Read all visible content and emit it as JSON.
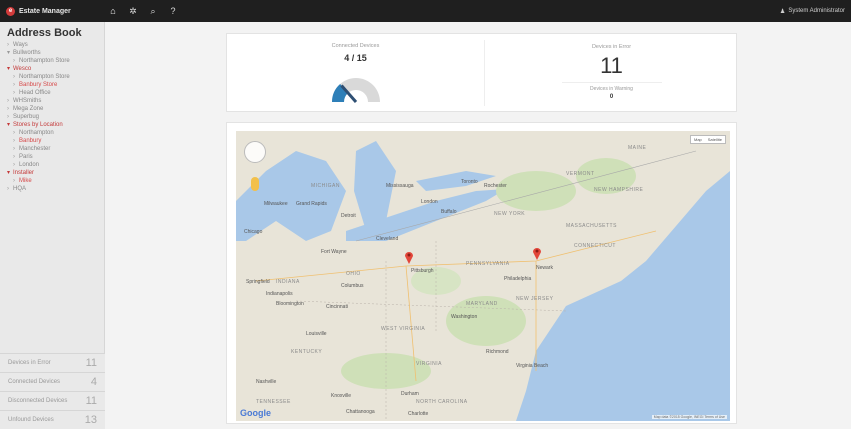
{
  "app": {
    "title": "Estate Manager",
    "logo_icon": "e-logo-icon"
  },
  "toolbar": {
    "tools": [
      {
        "name": "home-icon",
        "glyph": "⌂"
      },
      {
        "name": "gear-icon",
        "glyph": "✲"
      },
      {
        "name": "search-icon",
        "glyph": "⌕"
      },
      {
        "name": "help-icon",
        "glyph": "?"
      }
    ]
  },
  "user": {
    "icon": "user-icon",
    "name": "System Administrator"
  },
  "sidebar": {
    "title": "Address Book",
    "items": [
      {
        "label": "Ways",
        "marker": "›",
        "open": false,
        "selected": false,
        "indent": 0
      },
      {
        "label": "Bullworths",
        "marker": "▾",
        "open": false,
        "selected": false,
        "indent": 0
      },
      {
        "label": "Northampton Store",
        "marker": "›",
        "open": false,
        "selected": false,
        "indent": 1
      },
      {
        "label": "Wesco",
        "marker": "▾",
        "open": true,
        "selected": false,
        "indent": 0
      },
      {
        "label": "Northampton Store",
        "marker": "›",
        "open": false,
        "selected": false,
        "indent": 1
      },
      {
        "label": "Banbury Store",
        "marker": "›",
        "open": false,
        "selected": true,
        "indent": 1
      },
      {
        "label": "Head Office",
        "marker": "›",
        "open": false,
        "selected": false,
        "indent": 1
      },
      {
        "label": "WHSmiths",
        "marker": "›",
        "open": false,
        "selected": false,
        "indent": 0
      },
      {
        "label": "Mega Zone",
        "marker": "›",
        "open": false,
        "selected": false,
        "indent": 0
      },
      {
        "label": "Superbug",
        "marker": "›",
        "open": false,
        "selected": false,
        "indent": 0
      },
      {
        "label": "Stores by Location",
        "marker": "▾",
        "open": true,
        "selected": false,
        "indent": 0
      },
      {
        "label": "Northampton",
        "marker": "›",
        "open": false,
        "selected": false,
        "indent": 1
      },
      {
        "label": "Banbury",
        "marker": "›",
        "open": false,
        "selected": true,
        "indent": 1
      },
      {
        "label": "Manchester",
        "marker": "›",
        "open": false,
        "selected": false,
        "indent": 1
      },
      {
        "label": "Paris",
        "marker": "›",
        "open": false,
        "selected": false,
        "indent": 1
      },
      {
        "label": "London",
        "marker": "›",
        "open": false,
        "selected": false,
        "indent": 1
      },
      {
        "label": "Installer",
        "marker": "▾",
        "open": true,
        "selected": false,
        "indent": 0
      },
      {
        "label": "Mike",
        "marker": "›",
        "open": false,
        "selected": true,
        "indent": 1
      },
      {
        "label": "HQA",
        "marker": "›",
        "open": false,
        "selected": false,
        "indent": 0
      }
    ],
    "stats": [
      {
        "label": "Devices in Error",
        "value": "11"
      },
      {
        "label": "Connected Devices",
        "value": "4"
      },
      {
        "label": "Disconnected Devices",
        "value": "11"
      },
      {
        "label": "Unfound Devices",
        "value": "13"
      }
    ]
  },
  "summary": {
    "connected_caption": "Connected Devices",
    "connected_value": "4 / 15",
    "connected_fraction": 0.27,
    "error_caption": "Devices in Error",
    "error_value": "11",
    "warning_caption": "Devices in Warning",
    "warning_value": "0"
  },
  "map": {
    "type_buttons": [
      "Map",
      "Satellite"
    ],
    "attribution": "Map data ©2015 Google, INEGI",
    "terms": "Terms of Use",
    "google_logo": "Google",
    "labels": [
      {
        "text": "MAINE",
        "kind": "state"
      },
      {
        "text": "VERMONT",
        "kind": "state"
      },
      {
        "text": "NEW HAMPSHIRE",
        "kind": "state"
      },
      {
        "text": "MICHIGAN",
        "kind": "state"
      },
      {
        "text": "Mississauga",
        "kind": "city"
      },
      {
        "text": "Toronto",
        "kind": "city"
      },
      {
        "text": "London",
        "kind": "city"
      },
      {
        "text": "Buffalo",
        "kind": "city"
      },
      {
        "text": "Rochester",
        "kind": "city"
      },
      {
        "text": "NEW YORK",
        "kind": "state"
      },
      {
        "text": "MASSACHUSETTS",
        "kind": "state"
      },
      {
        "text": "CONNECTICUT",
        "kind": "state"
      },
      {
        "text": "Detroit",
        "kind": "city"
      },
      {
        "text": "Cleveland",
        "kind": "city"
      },
      {
        "text": "Chicago",
        "kind": "city"
      },
      {
        "text": "Milwaukee",
        "kind": "city"
      },
      {
        "text": "Grand Rapids",
        "kind": "city"
      },
      {
        "text": "Fort Wayne",
        "kind": "city"
      },
      {
        "text": "Pittsburgh",
        "kind": "city"
      },
      {
        "text": "PENNSYLVANIA",
        "kind": "state"
      },
      {
        "text": "Newark",
        "kind": "city"
      },
      {
        "text": "Philadelphia",
        "kind": "city"
      },
      {
        "text": "OHIO",
        "kind": "state"
      },
      {
        "text": "Columbus",
        "kind": "city"
      },
      {
        "text": "INDIANA",
        "kind": "state"
      },
      {
        "text": "Indianapolis",
        "kind": "city"
      },
      {
        "text": "MARYLAND",
        "kind": "state"
      },
      {
        "text": "NEW JERSEY",
        "kind": "state"
      },
      {
        "text": "Washington",
        "kind": "city"
      },
      {
        "text": "Cincinnati",
        "kind": "city"
      },
      {
        "text": "WEST VIRGINIA",
        "kind": "state"
      },
      {
        "text": "Louisville",
        "kind": "city"
      },
      {
        "text": "KENTUCKY",
        "kind": "state"
      },
      {
        "text": "VIRGINIA",
        "kind": "state"
      },
      {
        "text": "Richmond",
        "kind": "city"
      },
      {
        "text": "Virginia Beach",
        "kind": "city"
      },
      {
        "text": "Nashville",
        "kind": "city"
      },
      {
        "text": "TENNESSEE",
        "kind": "state"
      },
      {
        "text": "Knoxville",
        "kind": "city"
      },
      {
        "text": "Durham",
        "kind": "city"
      },
      {
        "text": "NORTH CAROLINA",
        "kind": "state"
      },
      {
        "text": "Charlotte",
        "kind": "city"
      },
      {
        "text": "Chattanooga",
        "kind": "city"
      },
      {
        "text": "Springfield",
        "kind": "city"
      },
      {
        "text": "Bloomington",
        "kind": "city"
      }
    ],
    "markers": [
      {
        "name": "Pittsburgh"
      },
      {
        "name": "Newark"
      }
    ]
  }
}
